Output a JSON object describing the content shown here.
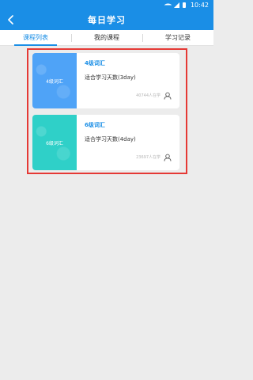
{
  "status_bar": {
    "time": "10:42"
  },
  "header": {
    "title": "每日学习"
  },
  "tabs": [
    {
      "label": "课程列表",
      "active": true
    },
    {
      "label": "我的课程",
      "active": false
    },
    {
      "label": "学习记录",
      "active": false
    }
  ],
  "courses": [
    {
      "thumb_label": "4级词汇",
      "title": "4级词汇",
      "description": "适合学习天数(3day)",
      "learners": "40744人在学",
      "thumb_color": "#4fa3f7"
    },
    {
      "thumb_label": "6级词汇",
      "title": "6级词汇",
      "description": "适合学习天数(4day)",
      "learners": "23697人在学",
      "thumb_color": "#2fd0c8"
    }
  ],
  "colors": {
    "primary": "#1a8ee6",
    "highlight_border": "#e53935",
    "background": "#ececec"
  },
  "icons": {
    "back": "chevron-left-icon",
    "user": "user-icon",
    "wifi": "wifi-icon",
    "signal": "signal-icon",
    "battery": "battery-icon"
  }
}
